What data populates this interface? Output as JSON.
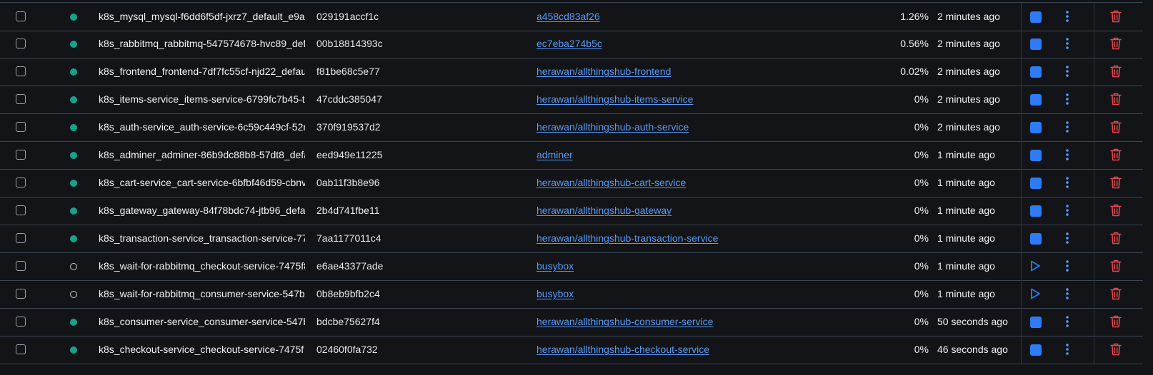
{
  "colors": {
    "background": "#121418",
    "row_border": "#3a4654",
    "running_status": "#15a489",
    "link": "#5a9bf5",
    "stop_button": "#2d7cf6",
    "delete_icon": "#e0494f"
  },
  "containers": [
    {
      "name": "k8s_mysql_mysql-f6dd6f5df-jxrz7_default_e9a",
      "id": "029191accf1c",
      "image": "a458cd83af26",
      "cpu": "1.26%",
      "created": "2 minutes ago",
      "status": "running"
    },
    {
      "name": "k8s_rabbitmq_rabbitmq-547574678-hvc89_def",
      "id": "00b18814393c",
      "image": "ec7eba274b5c",
      "cpu": "0.56%",
      "created": "2 minutes ago",
      "status": "running"
    },
    {
      "name": "k8s_frontend_frontend-7df7fc55cf-njd22_defau",
      "id": "f81be68c5e77",
      "image": "herawan/allthingshub-frontend",
      "cpu": "0.02%",
      "created": "2 minutes ago",
      "status": "running"
    },
    {
      "name": "k8s_items-service_items-service-6799fc7b45-t",
      "id": "47cddc385047",
      "image": "herawan/allthingshub-items-service",
      "cpu": "0%",
      "created": "2 minutes ago",
      "status": "running"
    },
    {
      "name": "k8s_auth-service_auth-service-6c59c449cf-52r",
      "id": "370f919537d2",
      "image": "herawan/allthingshub-auth-service",
      "cpu": "0%",
      "created": "2 minutes ago",
      "status": "running"
    },
    {
      "name": "k8s_adminer_adminer-86b9dc88b8-57dt8_defa",
      "id": "eed949e11225",
      "image": "adminer",
      "cpu": "0%",
      "created": "1 minute ago",
      "status": "running"
    },
    {
      "name": "k8s_cart-service_cart-service-6bfbf46d59-cbnv",
      "id": "0ab11f3b8e96",
      "image": "herawan/allthingshub-cart-service",
      "cpu": "0%",
      "created": "1 minute ago",
      "status": "running"
    },
    {
      "name": "k8s_gateway_gateway-84f78bdc74-jtb96_defau",
      "id": "2b4d741fbe11",
      "image": "herawan/allthingshub-gateway",
      "cpu": "0%",
      "created": "1 minute ago",
      "status": "running"
    },
    {
      "name": "k8s_transaction-service_transaction-service-77",
      "id": "7aa1177011c4",
      "image": "herawan/allthingshub-transaction-service",
      "cpu": "0%",
      "created": "1 minute ago",
      "status": "running"
    },
    {
      "name": "k8s_wait-for-rabbitmq_checkout-service-7475f8",
      "id": "e6ae43377ade",
      "image": "busybox",
      "cpu": "0%",
      "created": "1 minute ago",
      "status": "exited"
    },
    {
      "name": "k8s_wait-for-rabbitmq_consumer-service-547bb",
      "id": "0b8eb9bfb2c4",
      "image": "busybox",
      "cpu": "0%",
      "created": "1 minute ago",
      "status": "exited"
    },
    {
      "name": "k8s_consumer-service_consumer-service-547b",
      "id": "bdcbe75627f4",
      "image": "herawan/allthingshub-consumer-service",
      "cpu": "0%",
      "created": "50 seconds ago",
      "status": "running"
    },
    {
      "name": "k8s_checkout-service_checkout-service-7475f",
      "id": "02460f0fa732",
      "image": "herawan/allthingshub-checkout-service",
      "cpu": "0%",
      "created": "46 seconds ago",
      "status": "running"
    }
  ]
}
